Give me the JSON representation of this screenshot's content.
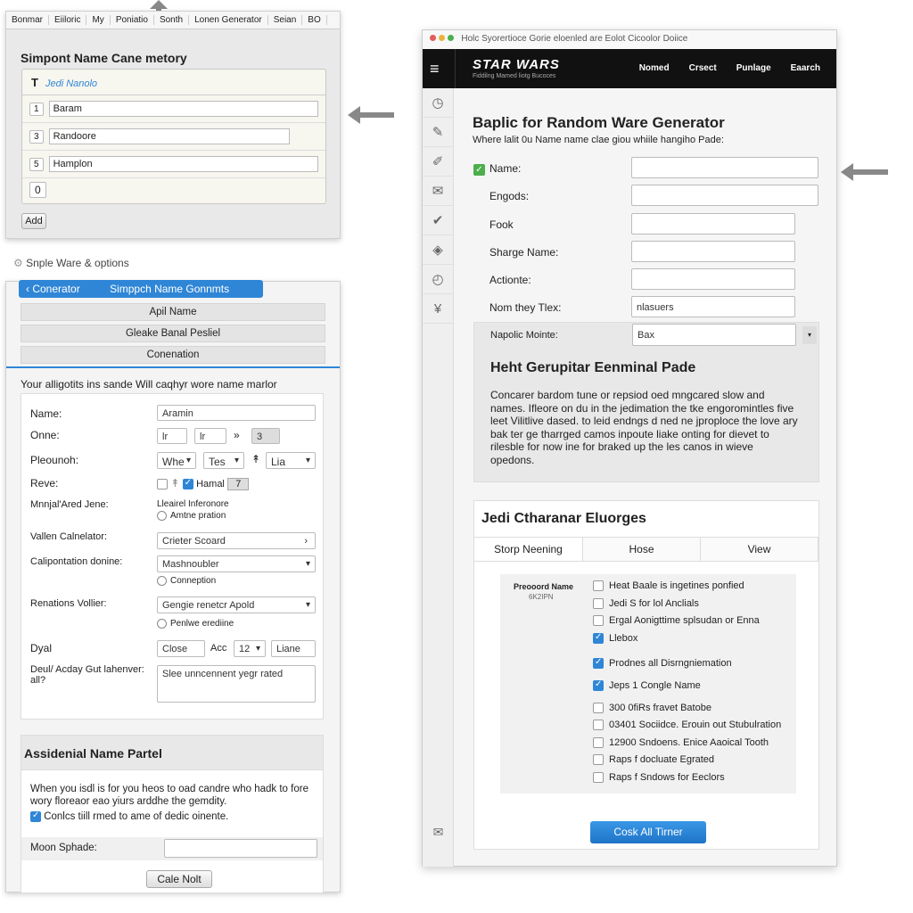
{
  "top_panel": {
    "tabs": [
      "Bonmar",
      "Eiiloric",
      "My",
      "Poniatio",
      "Sonth",
      "Lonen Generator",
      "Seian",
      "BO"
    ],
    "title": "Simpont Name Cane metory",
    "table_header_icon": "T",
    "table_header": "Jedi Nanolo",
    "rows": [
      {
        "n": "1",
        "v": "Baram"
      },
      {
        "n": "3",
        "v": "Randoore"
      },
      {
        "n": "5",
        "v": "Hamplon"
      }
    ],
    "last_row": "0",
    "add_label": "Add"
  },
  "section_label": "Snple Ware & options",
  "left_panel": {
    "header_back": "Conerator",
    "header_title": "Simppch Name Gonnmts",
    "buttons": [
      "Apil Name",
      "Gleake Banal Pesliel",
      "Conenation"
    ],
    "description": "Your alligotits ins sande Will caqhyr wore name marlor",
    "form": {
      "name_label": "Name:",
      "name_value": "Aramin",
      "onne_label": "Onne:",
      "onne_values": [
        "lr",
        "lr",
        "3"
      ],
      "pseuonh_label": "Pleounoh:",
      "pseuonh_selects": [
        "Whe",
        "Tes",
        "Lia"
      ],
      "reve_label": "Reve:",
      "reve_check_label": "Hamal",
      "reve_stepper": "7",
      "mnnjal_label": "Mnnjal'Ared Jene:",
      "mnnjal_text": "Lleairel Inferonore",
      "mnnjal_radio": "Amtne pration",
      "vallen_label": "Vallen Calnelator:",
      "vallen_value": "Crieter Scoard",
      "calip_label": "Calipontation donine:",
      "calip_value": "Mashnoubler",
      "calip_radio": "Conneption",
      "renations_label": "Renations Vollier:",
      "renations_value": "Gengie renetcr Apold",
      "renations_radio": "Penlwe erediine",
      "dyal_label": "Dyal",
      "dyal_value1": "Close",
      "dyal_acc": "Acc",
      "dyal_value2": "12",
      "dyal_value3": "Liane",
      "deul_label": "Deul/ Acday Gut lahenver: all?",
      "deul_value": "Slee unncennent yegr rated"
    },
    "assid": {
      "title": "Assidenial Name Partel",
      "text": "When you isdl is for you heos to oad candre who hadk to fore wory floreaor eao yiurs arddhe the gemdity.",
      "check_label": "Conlcs tiill rmed to ame of dedic oinente.",
      "moon_label": "Moon Sphade:",
      "moon_value": "",
      "button": "Cale Nolt"
    }
  },
  "window": {
    "title": "Holc Syorertioce Gorie eloenled are Eolot Cicoolor Doiice",
    "brand": "STAR WARS",
    "brand_sub": "Fiddilng Mamed liotg Bucoces",
    "nav": [
      "Nomed",
      "Crsect",
      "Punlage",
      "Eaarch"
    ],
    "sidebar_icons": [
      "clock-icon",
      "pen-icon",
      "tool-icon",
      "mail-icon",
      "check-icon",
      "tag-icon",
      "timer-icon",
      "figure-icon"
    ],
    "heading": "Baplic for Random Ware Generator",
    "subheading": "Where lalit 0u Name name clae giou whiile hangiho Pade:",
    "fields": [
      {
        "label": "Name:",
        "value": "",
        "checked": true
      },
      {
        "label": "Engods:",
        "value": ""
      },
      {
        "label": "Fook",
        "value": ""
      },
      {
        "label": "Sharge Name:",
        "value": ""
      },
      {
        "label": "Actionte:",
        "value": ""
      },
      {
        "label": "Nom they Tlex:",
        "value": "nlasuers"
      }
    ],
    "napolic_label": "Napolic Mointe:",
    "napolic_value": "Bax",
    "info_title": "Heht Gerupitar Eenminal Pade",
    "info_text": "Concarer bardom tune or repsiod oed mngcared slow and names. Ifleore on du in the jedimation the tke engoromintles five leet Vilitlive dased. to leid endngs d ned ne jproploce the love ary bak ter ge tharrged camos inpoute liake onting for dievet to rilesble for now ine for braked up the les canos in wieve opedons.",
    "jedi": {
      "title": "Jedi Ctharanar Eluorges",
      "tabs": [
        "Storp Neening",
        "Hose",
        "View"
      ],
      "list_label": "Preooord Name",
      "list_sub": "6K2IPN",
      "items": [
        {
          "label": "Heat Baale is ingetines ponfied",
          "checked": false
        },
        {
          "label": "Jedi S for lol Anclials",
          "checked": false
        },
        {
          "label": "Ergal Aonigttime splsudan or Enna",
          "checked": false
        },
        {
          "label": "Llebox",
          "checked": true
        },
        {
          "label": "Prodnes all Disrngniemation",
          "checked": true
        },
        {
          "label": "Jeps 1 Congle Name",
          "checked": true
        },
        {
          "label": "300 0fiRs fravet Batobe",
          "checked": false
        },
        {
          "label": "03401 Sociidce. Erouin out Stubulration",
          "checked": false
        },
        {
          "label": "12900 Sndoens. Enice Aaoical Tooth",
          "checked": false
        },
        {
          "label": "Raps f docluate Egrated",
          "checked": false
        },
        {
          "label": "Raps f Sndows for Eeclors",
          "checked": false
        }
      ],
      "button": "Cosk All Tirner"
    }
  },
  "colors": {
    "accent": "#2f86d6",
    "header_bg": "#111111",
    "check_green": "#4cae4c"
  }
}
